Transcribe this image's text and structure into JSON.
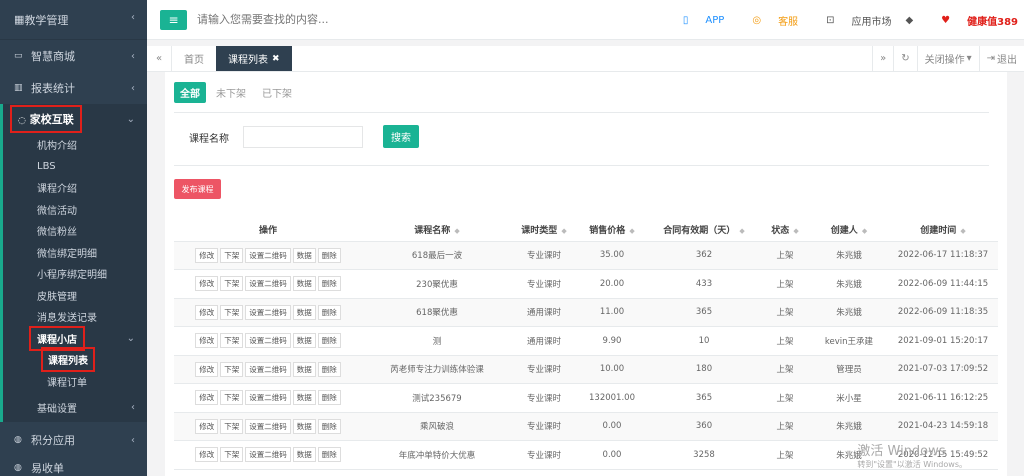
{
  "sidebar": {
    "top_item": "教学管理",
    "items": [
      {
        "icon": "cart-icon",
        "label": "智慧商城"
      },
      {
        "icon": "chart-icon",
        "label": "报表统计"
      }
    ],
    "section": {
      "label": "家校互联",
      "subitems": [
        "机构介绍",
        "LBS",
        "课程介绍",
        "微信活动",
        "微信粉丝",
        "微信绑定明细",
        "小程序绑定明细",
        "皮肤管理",
        "消息发送记录"
      ],
      "shop": {
        "label": "课程小店",
        "children": [
          "课程列表",
          "课程订单"
        ]
      },
      "basic": "基础设置"
    },
    "bottom_items": [
      {
        "icon": "points-icon",
        "label": "积分应用"
      },
      {
        "icon": "coupon-icon",
        "label": "易收单"
      }
    ]
  },
  "topbar": {
    "search_placeholder": "请输入您需要查找的内容...",
    "app": "APP",
    "kefu": "客服",
    "market": "应用市场",
    "health": "健康值389"
  },
  "tabs": {
    "home": "首页",
    "active": "课程列表",
    "close_ops": "关闭操作",
    "logout": "退出"
  },
  "filters": [
    "全部",
    "未下架",
    "已下架"
  ],
  "search": {
    "label": "课程名称",
    "button": "搜索"
  },
  "publish_button": "发布课程",
  "table": {
    "headers": [
      "操作",
      "课程名称",
      "课时类型",
      "销售价格",
      "合同有效期（天）",
      "状态",
      "创建人",
      "创建时间"
    ],
    "ops": [
      "修改",
      "下架",
      "设置二维码",
      "数据",
      "删除"
    ],
    "rows": [
      {
        "name": "618最后一波",
        "type": "专业课时",
        "price": "35.00",
        "days": "362",
        "status": "上架",
        "creator": "朱兆娥",
        "time": "2022-06-17 11:18:37"
      },
      {
        "name": "230聚优惠",
        "type": "专业课时",
        "price": "20.00",
        "days": "433",
        "status": "上架",
        "creator": "朱兆娥",
        "time": "2022-06-09 11:44:15"
      },
      {
        "name": "618聚优惠",
        "type": "通用课时",
        "price": "11.00",
        "days": "365",
        "status": "上架",
        "creator": "朱兆娥",
        "time": "2022-06-09 11:18:35"
      },
      {
        "name": "测",
        "type": "通用课时",
        "price": "9.90",
        "days": "10",
        "status": "上架",
        "creator": "kevin王承建",
        "time": "2021-09-01 15:20:17"
      },
      {
        "name": "芮老师专注力训练体验课",
        "type": "专业课时",
        "price": "10.00",
        "days": "180",
        "status": "上架",
        "creator": "管理员",
        "time": "2021-07-03 17:09:52"
      },
      {
        "name": "测试235679",
        "type": "专业课时",
        "price": "132001.00",
        "days": "365",
        "status": "上架",
        "creator": "米小星",
        "time": "2021-06-11 16:12:25"
      },
      {
        "name": "乘风破浪",
        "type": "专业课时",
        "price": "0.00",
        "days": "360",
        "status": "上架",
        "creator": "朱兆娥",
        "time": "2021-04-23 14:59:18"
      },
      {
        "name": "年底冲单特价大优惠",
        "type": "专业课时",
        "price": "0.00",
        "days": "3258",
        "status": "上架",
        "creator": "朱兆娥",
        "time": "2020-12-15 15:49:52"
      }
    ]
  },
  "watermark": {
    "line1": "激活 Windows",
    "line2": "转到\"设置\"以激活 Windows。"
  },
  "colors": {
    "sidebar": "#2f4050",
    "accent": "#1ab394",
    "danger": "#ed5565",
    "highlight": "#e0201a"
  }
}
